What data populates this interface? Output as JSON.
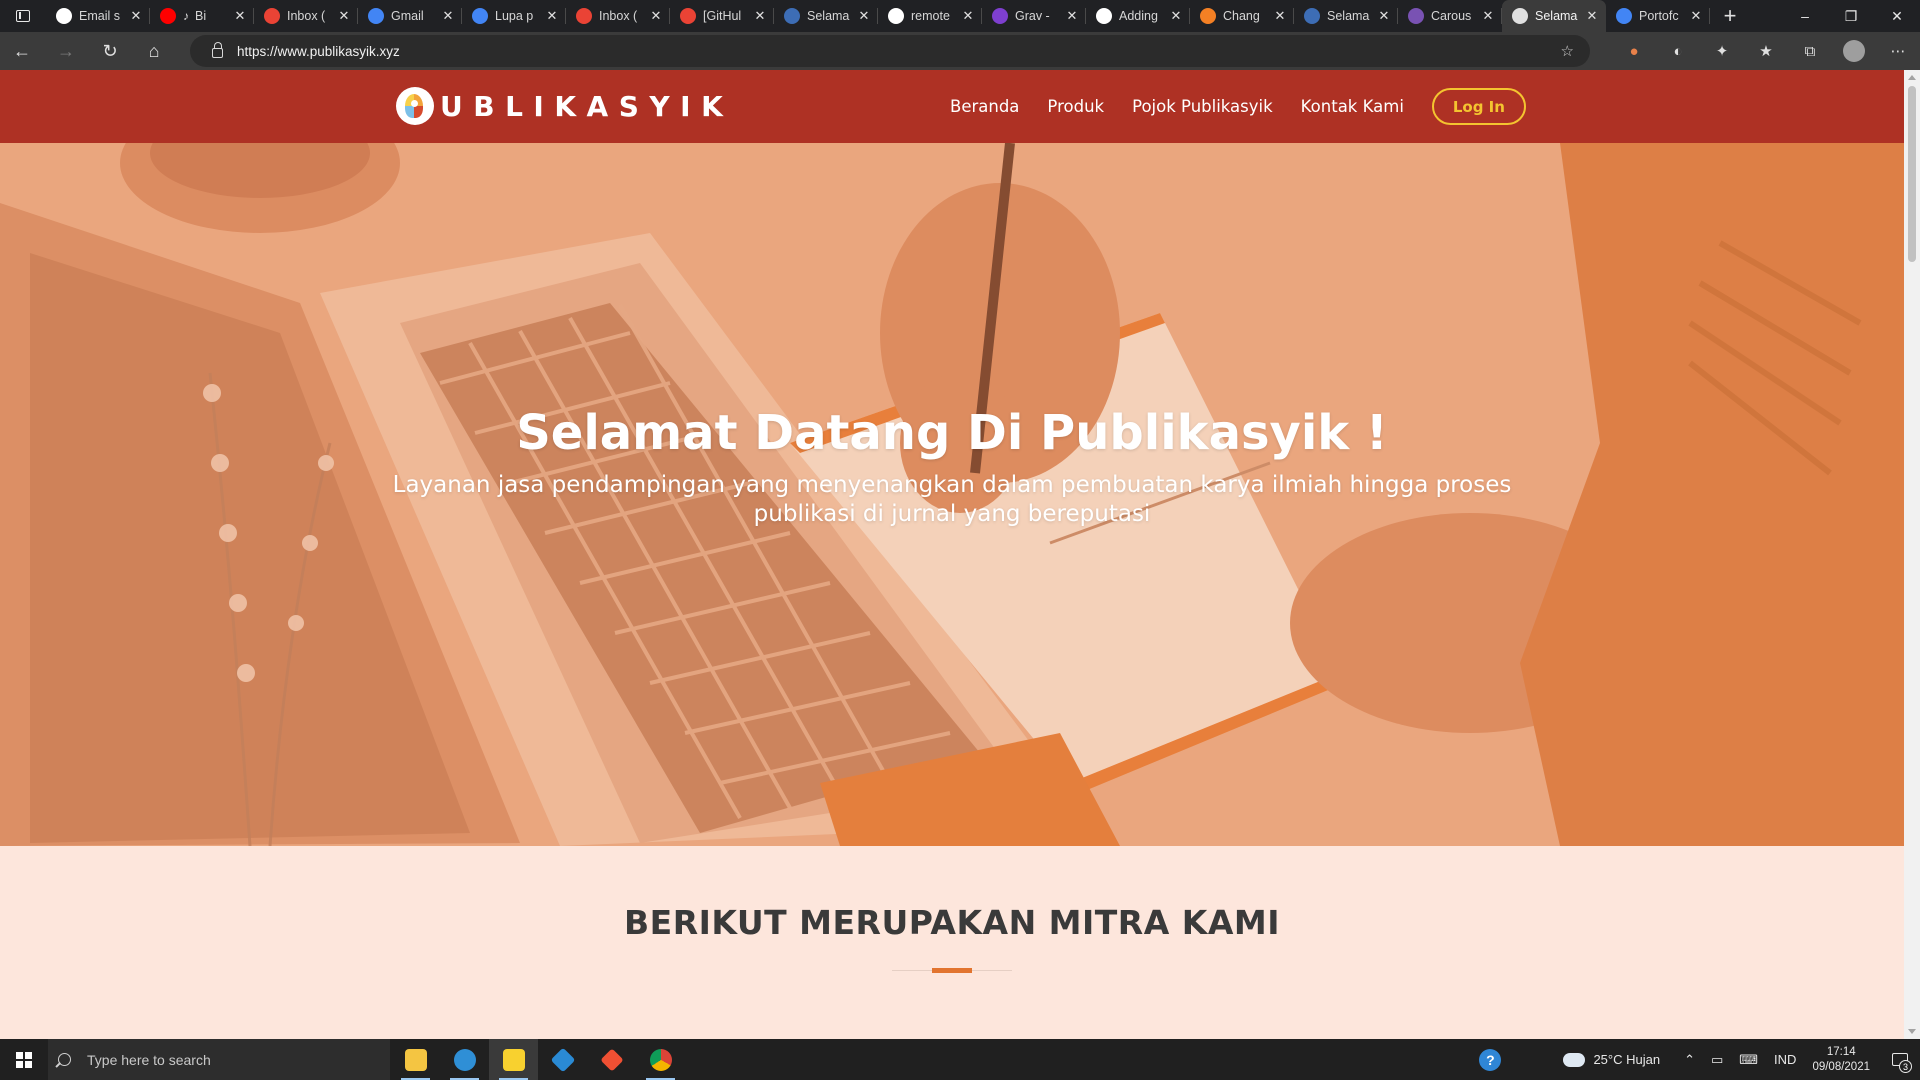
{
  "browser": {
    "tabs": [
      {
        "title": "Email s",
        "icon": "github-icon",
        "color": "#ffffff"
      },
      {
        "title": "Bi",
        "icon": "youtube-icon",
        "color": "#ff0000",
        "audio": true
      },
      {
        "title": "Inbox (",
        "icon": "gmail-icon",
        "color": "#ea4335"
      },
      {
        "title": "Gmail",
        "icon": "google-icon",
        "color": "#4285f4"
      },
      {
        "title": "Lupa p",
        "icon": "google-icon",
        "color": "#4285f4"
      },
      {
        "title": "Inbox (",
        "icon": "gmail-icon",
        "color": "#ea4335"
      },
      {
        "title": "[GitHul",
        "icon": "gmail-icon",
        "color": "#ea4335"
      },
      {
        "title": "Selama",
        "icon": "person-icon",
        "color": "#3d6db5"
      },
      {
        "title": "remote",
        "icon": "github-icon",
        "color": "#ffffff"
      },
      {
        "title": "Grav -",
        "icon": "grav-icon",
        "color": "#7e3fcf"
      },
      {
        "title": "Adding",
        "icon": "github-icon",
        "color": "#ffffff"
      },
      {
        "title": "Chang",
        "icon": "stackoverflow-icon",
        "color": "#f48024"
      },
      {
        "title": "Selama",
        "icon": "person-icon",
        "color": "#3d6db5"
      },
      {
        "title": "Carous",
        "icon": "bootstrap-icon",
        "color": "#7952b3"
      },
      {
        "title": "Selama",
        "icon": "publikasyik-icon",
        "color": "#e0e0e0",
        "active": true
      },
      {
        "title": "Portofc",
        "icon": "docs-icon",
        "color": "#4285f4"
      }
    ],
    "url": "https://www.publikasyik.xyz"
  },
  "site": {
    "brand": "UBLIKASYIK",
    "menu": {
      "home": "Beranda",
      "products": "Produk",
      "corner": "Pojok Publikasyik",
      "contact": "Kontak Kami"
    },
    "login": "Log In",
    "hero": {
      "title": "Selamat Datang Di Publikasyik !",
      "subtitle": "Layanan jasa pendampingan yang menyenangkan dalam pembuatan karya ilmiah hingga proses publikasi di jurnal yang bereputasi"
    },
    "partners": {
      "heading": "BERIKUT MERUPAKAN MITRA KAMI"
    },
    "colors": {
      "nav": "#ae3124",
      "accent": "#f4c430",
      "underline": "#e2742f",
      "background": "#fde6dc"
    }
  },
  "taskbar": {
    "search_placeholder": "Type here to search",
    "weather": "25°C  Hujan",
    "language": "IND",
    "time": "17:14",
    "date": "09/08/2021",
    "notifications": "3"
  }
}
